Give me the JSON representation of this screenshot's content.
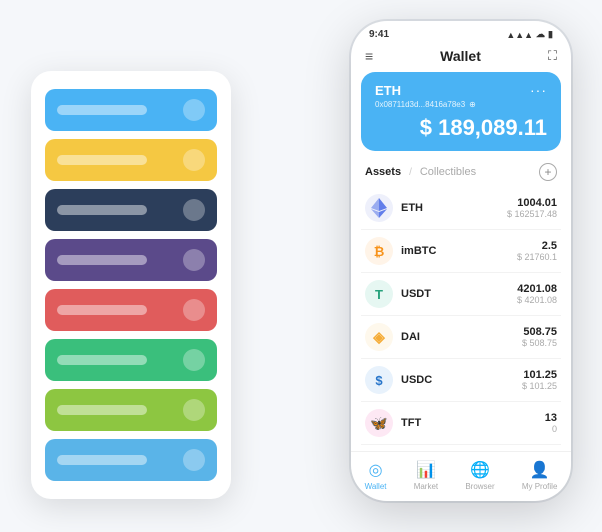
{
  "scene": {
    "card_stack": {
      "cards": [
        {
          "color": "card-blue",
          "label": ""
        },
        {
          "color": "card-yellow",
          "label": ""
        },
        {
          "color": "card-dark",
          "label": ""
        },
        {
          "color": "card-purple",
          "label": ""
        },
        {
          "color": "card-red",
          "label": ""
        },
        {
          "color": "card-green",
          "label": ""
        },
        {
          "color": "card-lime",
          "label": ""
        },
        {
          "color": "card-sky",
          "label": ""
        }
      ]
    },
    "phone": {
      "status_bar": {
        "time": "9:41",
        "signal": "●●●",
        "wifi": "▲",
        "battery": "▮"
      },
      "header": {
        "menu_icon": "≡",
        "title": "Wallet",
        "expand_icon": "⛶"
      },
      "eth_card": {
        "title": "ETH",
        "dots": "···",
        "address": "0x08711d3d...8416a78e3",
        "copy_icon": "⊕",
        "dollar_sign": "$",
        "amount": "189,089.11"
      },
      "assets_section": {
        "tab_active": "Assets",
        "tab_divider": "/",
        "tab_inactive": "Collectibles",
        "add_icon": "+"
      },
      "assets": [
        {
          "icon": "◆",
          "icon_color": "#627EEA",
          "name": "ETH",
          "amount": "1004.01",
          "value": "$ 162517.48"
        },
        {
          "icon": "₿",
          "icon_color": "#F7931A",
          "name": "imBTC",
          "amount": "2.5",
          "value": "$ 21760.1"
        },
        {
          "icon": "T",
          "icon_color": "#26A17B",
          "name": "USDT",
          "amount": "4201.08",
          "value": "$ 4201.08"
        },
        {
          "icon": "◈",
          "icon_color": "#F5AC37",
          "name": "DAI",
          "amount": "508.75",
          "value": "$ 508.75"
        },
        {
          "icon": "$",
          "icon_color": "#2775CA",
          "name": "USDC",
          "amount": "101.25",
          "value": "$ 101.25"
        },
        {
          "icon": "🦋",
          "icon_color": "#E91E8C",
          "name": "TFT",
          "amount": "13",
          "value": "0"
        }
      ],
      "bottom_nav": [
        {
          "icon": "◎",
          "label": "Wallet",
          "active": true
        },
        {
          "icon": "📈",
          "label": "Market",
          "active": false
        },
        {
          "icon": "🌐",
          "label": "Browser",
          "active": false
        },
        {
          "icon": "👤",
          "label": "My Profile",
          "active": false
        }
      ]
    }
  }
}
